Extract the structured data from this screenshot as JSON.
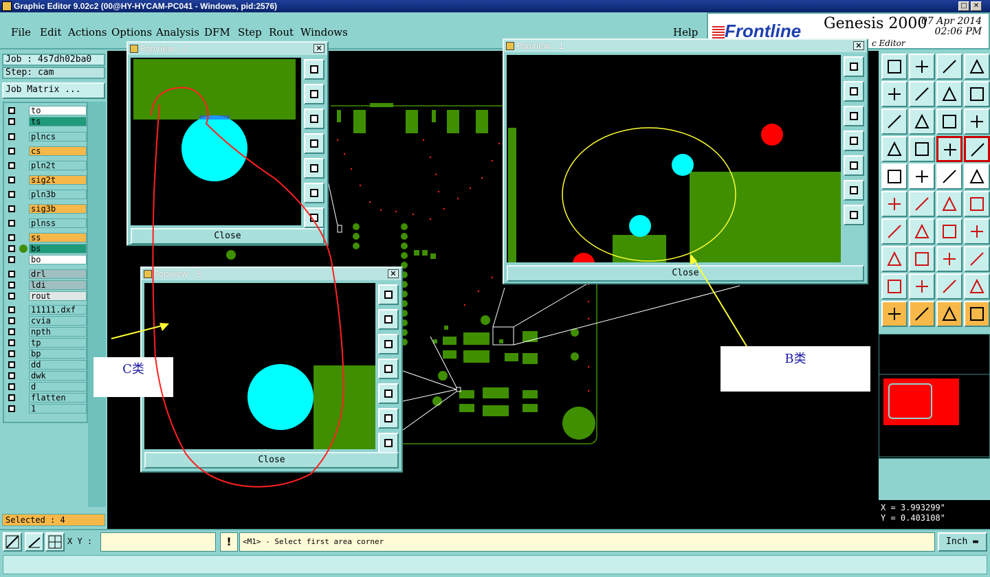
{
  "window": {
    "title": "Graphic Editor 9.02c2 (00@HY-HYCAM-PC041 - Windows, pid:2576)"
  },
  "menu": [
    "File",
    "Edit",
    "Actions",
    "Options",
    "Analysis",
    "DFM",
    "Step",
    "Rout",
    "Windows"
  ],
  "help_label": "Help",
  "brand": {
    "logo": "Frontline",
    "product": "Genesis 2000",
    "date": "07 Apr 2014",
    "time": "02:06 PM",
    "subtitle": "c Editor"
  },
  "job": {
    "label": "Job : 4s7dh02ba0",
    "step": "Step: cam",
    "matrix_button": "Job Matrix ..."
  },
  "layers": [
    {
      "name": "to",
      "color": "#ffffff"
    },
    {
      "name": "ts",
      "color": "#1f9a7a"
    },
    {
      "name": "plncs",
      "color": "#8fd3cf"
    },
    {
      "name": "cs",
      "color": "#f7b84a"
    },
    {
      "name": "pln2t",
      "color": "#8fd3cf"
    },
    {
      "name": "sig2t",
      "color": "#f7b84a"
    },
    {
      "name": "pln3b",
      "color": "#8fd3cf"
    },
    {
      "name": "sig3b",
      "color": "#f7b84a"
    },
    {
      "name": "plnss",
      "color": "#8fd3cf"
    },
    {
      "name": "ss",
      "color": "#f7b84a"
    },
    {
      "name": "bs",
      "color": "#1f9a7a"
    },
    {
      "name": "bo",
      "color": "#ffffff"
    },
    {
      "name": "drl",
      "color": "#9fbfc0"
    },
    {
      "name": "ldi",
      "color": "#9fbfc0"
    },
    {
      "name": "rout",
      "color": "#dfe6e6"
    },
    {
      "name": "11111.dxf",
      "color": "#8fd3cf"
    },
    {
      "name": "cvia",
      "color": "#8fd3cf"
    },
    {
      "name": "npth",
      "color": "#8fd3cf"
    },
    {
      "name": "tp",
      "color": "#8fd3cf"
    },
    {
      "name": "bp",
      "color": "#8fd3cf"
    },
    {
      "name": "dd",
      "color": "#8fd3cf"
    },
    {
      "name": "dwk",
      "color": "#8fd3cf"
    },
    {
      "name": "d",
      "color": "#8fd3cf"
    },
    {
      "name": "flatten",
      "color": "#8fd3cf"
    },
    {
      "name": "1",
      "color": "#8fd3cf"
    }
  ],
  "selected": "Selected : 4",
  "popups": {
    "p1": {
      "title": "Popview - 1",
      "close": "Close"
    },
    "p2": {
      "title": "Popview - 2",
      "close": "Close"
    },
    "p3": {
      "title": "Popview - 3",
      "close": "Close"
    }
  },
  "annotations": {
    "b": "B类",
    "c": "C类"
  },
  "coords": {
    "x": "X = 3.993299\"",
    "y": "Y = 0.403108\""
  },
  "bottom": {
    "xy_label": "X Y :",
    "xy_value": "",
    "prompt": "<M1> - Select first area corner",
    "units": "Inch",
    "excl": "!"
  },
  "colors": {
    "pad": "#3f8f00",
    "via": "#00ffff",
    "hole": "#ff0000",
    "highlight": "#ffff33",
    "markup": "#ff2020"
  }
}
